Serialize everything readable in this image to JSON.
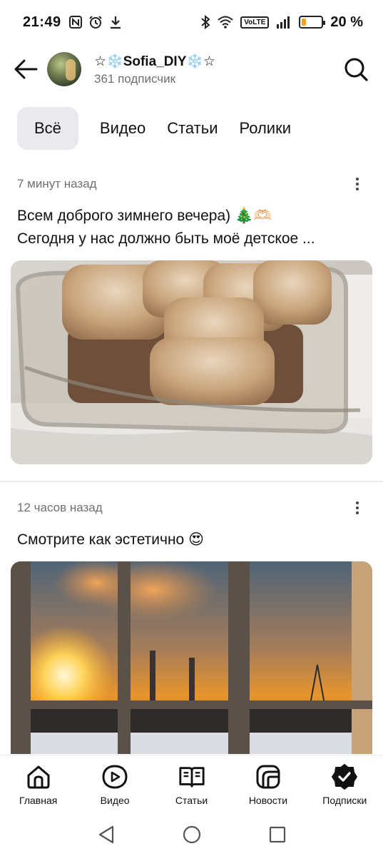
{
  "status_bar": {
    "time": "21:49",
    "network": "VoLTE",
    "battery_percent": "20 %",
    "battery_level": 0.2
  },
  "header": {
    "channel_name": "☆❄️Sofia_DIY❄️☆",
    "subscribers": "361 подписчик",
    "back_icon": "arrow-left-icon",
    "search_icon": "search-icon"
  },
  "tabs": [
    {
      "label": "Всё",
      "active": true
    },
    {
      "label": "Видео",
      "active": false
    },
    {
      "label": "Статьи",
      "active": false
    },
    {
      "label": "Ролики",
      "active": false
    }
  ],
  "posts": [
    {
      "time": "7 минут назад",
      "text_line1": "Всем доброго зимнего вечера) 🎄🫶🏻",
      "text_line2": "Сегодня у нас должно быть моё детское ..."
    },
    {
      "time": "12 часов назад",
      "text_line1": "Смотрите как эстетично 😍"
    }
  ],
  "bottom_nav": [
    {
      "label": "Главная",
      "icon": "home-icon"
    },
    {
      "label": "Видео",
      "icon": "video-icon"
    },
    {
      "label": "Статьи",
      "icon": "articles-icon"
    },
    {
      "label": "Новости",
      "icon": "news-icon"
    },
    {
      "label": "Подписки",
      "icon": "subscriptions-icon",
      "active": true
    }
  ],
  "colors": {
    "active_tab_bg": "#e9e9ee",
    "meta_text": "#707070",
    "battery": "#f0a020"
  }
}
